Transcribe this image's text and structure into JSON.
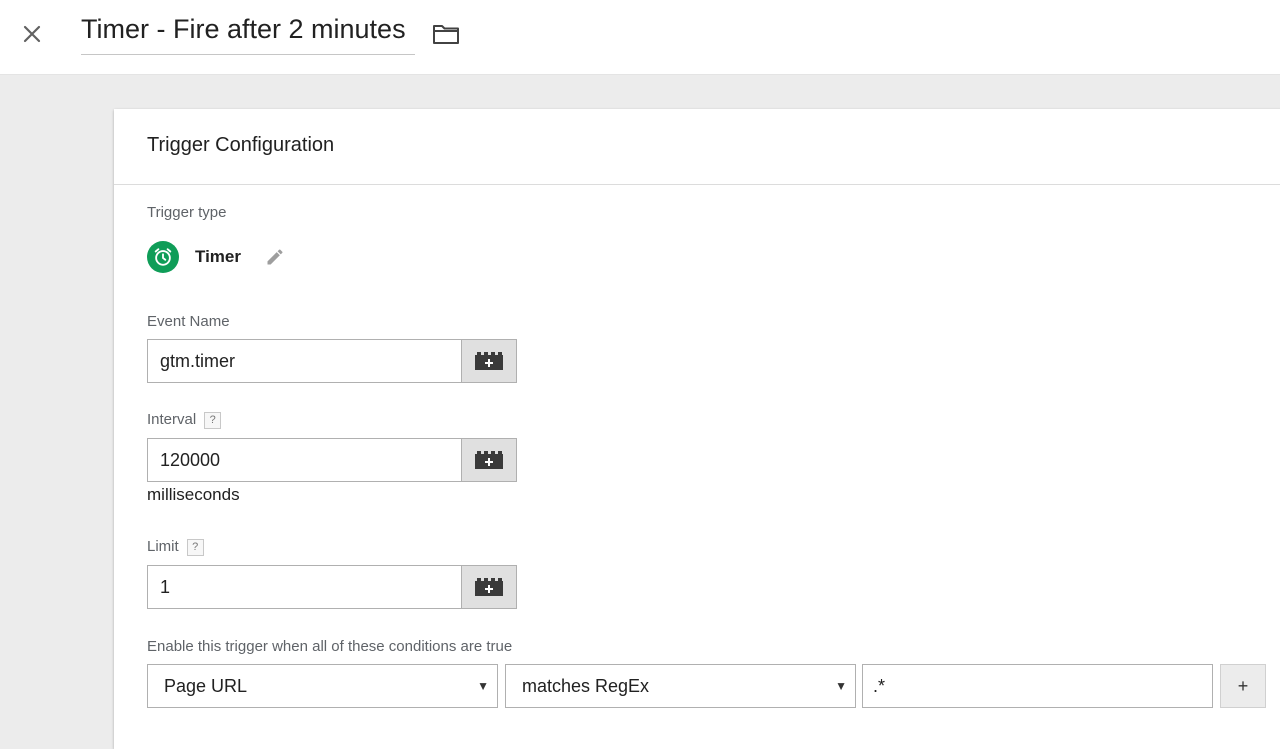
{
  "header": {
    "title": "Timer - Fire after 2 minutes",
    "close_icon": "close-icon",
    "folder_icon": "folder-icon"
  },
  "card": {
    "title": "Trigger Configuration",
    "trigger_type": {
      "label": "Trigger type",
      "name": "Timer",
      "icon": "timer-icon",
      "badge_color": "#0f9d58",
      "edit_icon": "pencil-icon"
    },
    "event_name": {
      "label": "Event Name",
      "value": "gtm.timer"
    },
    "interval": {
      "label": "Interval",
      "help": "?",
      "value": "120000",
      "unit": "milliseconds"
    },
    "limit": {
      "label": "Limit",
      "help": "?",
      "value": "1"
    },
    "conditions": {
      "label": "Enable this trigger when all of these conditions are true",
      "variable": "Page URL",
      "operator": "matches RegEx",
      "value": ".*",
      "add_label": "+"
    },
    "variable_button_icon": "add-variable-icon"
  }
}
